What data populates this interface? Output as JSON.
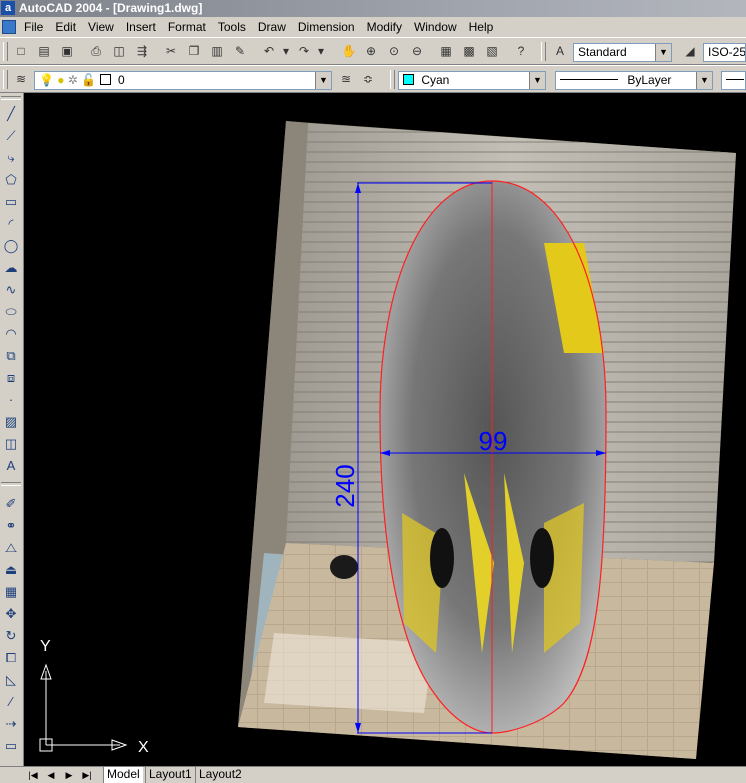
{
  "window": {
    "title": "AutoCAD 2004 - [Drawing1.dwg]",
    "app_icon_glyph": "a"
  },
  "menu": [
    "File",
    "Edit",
    "View",
    "Insert",
    "Format",
    "Tools",
    "Draw",
    "Dimension",
    "Modify",
    "Window",
    "Help"
  ],
  "toolbar": {
    "text_style": "Standard",
    "dim_style": "ISO-25",
    "layer": "0",
    "color": "Cyan",
    "color_hex": "#00ffff",
    "linetype": "ByLayer"
  },
  "drawing": {
    "dimension_length": "240",
    "dimension_width": "99",
    "ucs_x": "X",
    "ucs_y": "Y",
    "dim_color": "#0000ff",
    "outline_color": "#ff2020"
  },
  "tabs": [
    "Model",
    "Layout1",
    "Layout2"
  ]
}
